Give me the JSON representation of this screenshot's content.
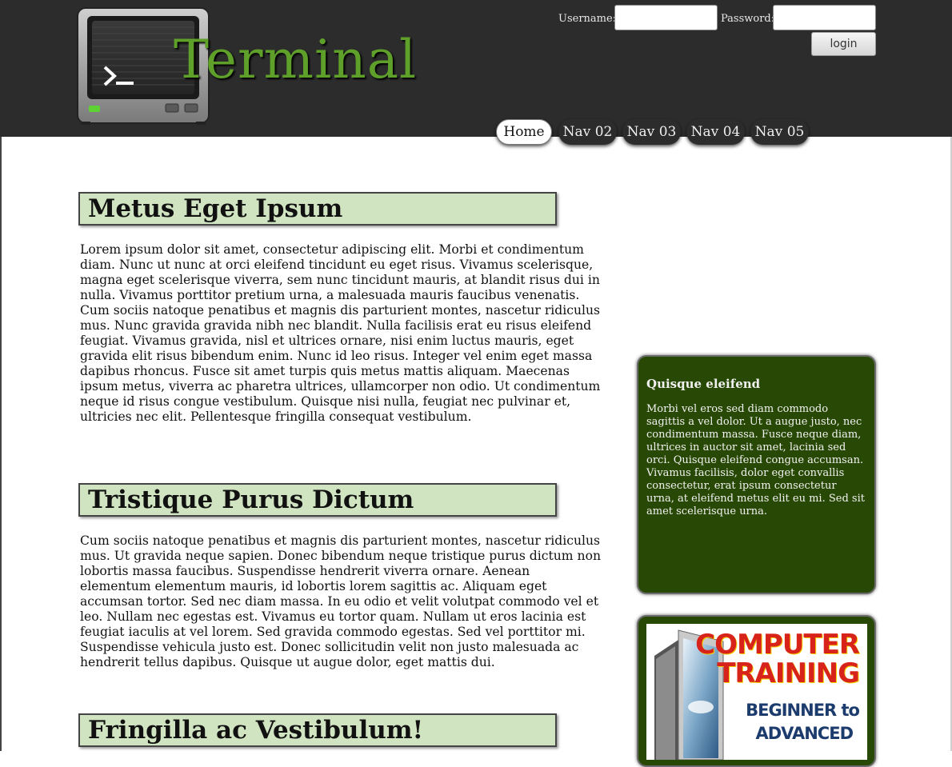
{
  "header": {
    "site_title": "Terminal",
    "logo_icon": "terminal-monitor-icon",
    "login": {
      "username_label": "Username:",
      "password_label": "Password:",
      "username_value": "",
      "password_value": "",
      "login_button": "login"
    },
    "nav": [
      {
        "label": "Home",
        "active": true
      },
      {
        "label": "Nav 02",
        "active": false
      },
      {
        "label": "Nav 03",
        "active": false
      },
      {
        "label": "Nav 04",
        "active": false
      },
      {
        "label": "Nav 05",
        "active": false
      }
    ]
  },
  "main": {
    "sections": [
      {
        "heading": "Metus Eget Ipsum",
        "body": "Lorem ipsum dolor sit amet, consectetur adipiscing elit. Morbi et condimentum diam. Nunc ut nunc at orci eleifend tincidunt eu eget risus. Vivamus scelerisque, magna eget scelerisque viverra, sem nunc tincidunt mauris, at blandit risus dui in nulla. Vivamus porttitor pretium urna, a malesuada mauris faucibus venenatis. Cum sociis natoque penatibus et magnis dis parturient montes, nascetur ridiculus mus. Nunc gravida gravida nibh nec blandit. Nulla facilisis erat eu risus eleifend feugiat. Vivamus gravida, nisl et ultrices ornare, nisi enim luctus mauris, eget gravida elit risus bibendum enim. Nunc id leo risus. Integer vel enim eget massa dapibus rhoncus. Fusce sit amet turpis quis metus mattis aliquam. Maecenas ipsum metus, viverra ac pharetra ultrices, ullamcorper non odio. Ut condimentum neque id risus congue vestibulum. Quisque nisi nulla, feugiat nec pulvinar et, ultricies nec elit. Pellentesque fringilla consequat vestibulum."
      },
      {
        "heading": "Tristique Purus Dictum",
        "body": "Cum sociis natoque penatibus et magnis dis parturient montes, nascetur ridiculus mus. Ut gravida neque sapien. Donec bibendum neque tristique purus dictum non lobortis massa faucibus. Suspendisse hendrerit viverra ornare. Aenean elementum elementum mauris, id lobortis lorem sagittis ac. Aliquam eget accumsan tortor. Sed nec diam massa. In eu odio et velit volutpat commodo vel et leo. Nullam nec egestas est. Vivamus eu tortor quam. Nullam ut eros lacinia est feugiat iaculis at vel lorem. Sed gravida commodo egestas. Sed vel porttitor mi. Suspendisse vehicula justo est. Donec sollicitudin velit non justo malesuada ac hendrerit tellus dapibus. Quisque ut augue dolor, eget mattis dui."
      },
      {
        "heading": "Fringilla ac Vestibulum!",
        "body": ""
      }
    ]
  },
  "sidebar": {
    "box_title": "Quisque eleifend",
    "box_text": "Morbi vel eros sed diam commodo sagittis a vel dolor. Ut a augue justo, nec condimentum massa. Fusce neque diam, ultrices in auctor sit amet, lacinia sed orci. Quisque eleifend congue accumsan. Vivamus facilisis, dolor eget convallis consectetur, erat ipsum consectetur urna, at eleifend metus elit eu mi. Sed sit amet scelerisque urna.",
    "ad": {
      "line1": "COMPUTER",
      "line2": "TRAINING",
      "line3": "BEGINNER to",
      "line4": "ADVANCED",
      "icon": "computer-monitor-image"
    }
  },
  "colors": {
    "header_bg": "#2c2c2c",
    "title_green": "#5ea02a",
    "heading_bg": "#d1e4c1",
    "sidebar_bg": "#284905",
    "ad_red": "#d8231b",
    "ad_navy": "#1d3c6e"
  }
}
